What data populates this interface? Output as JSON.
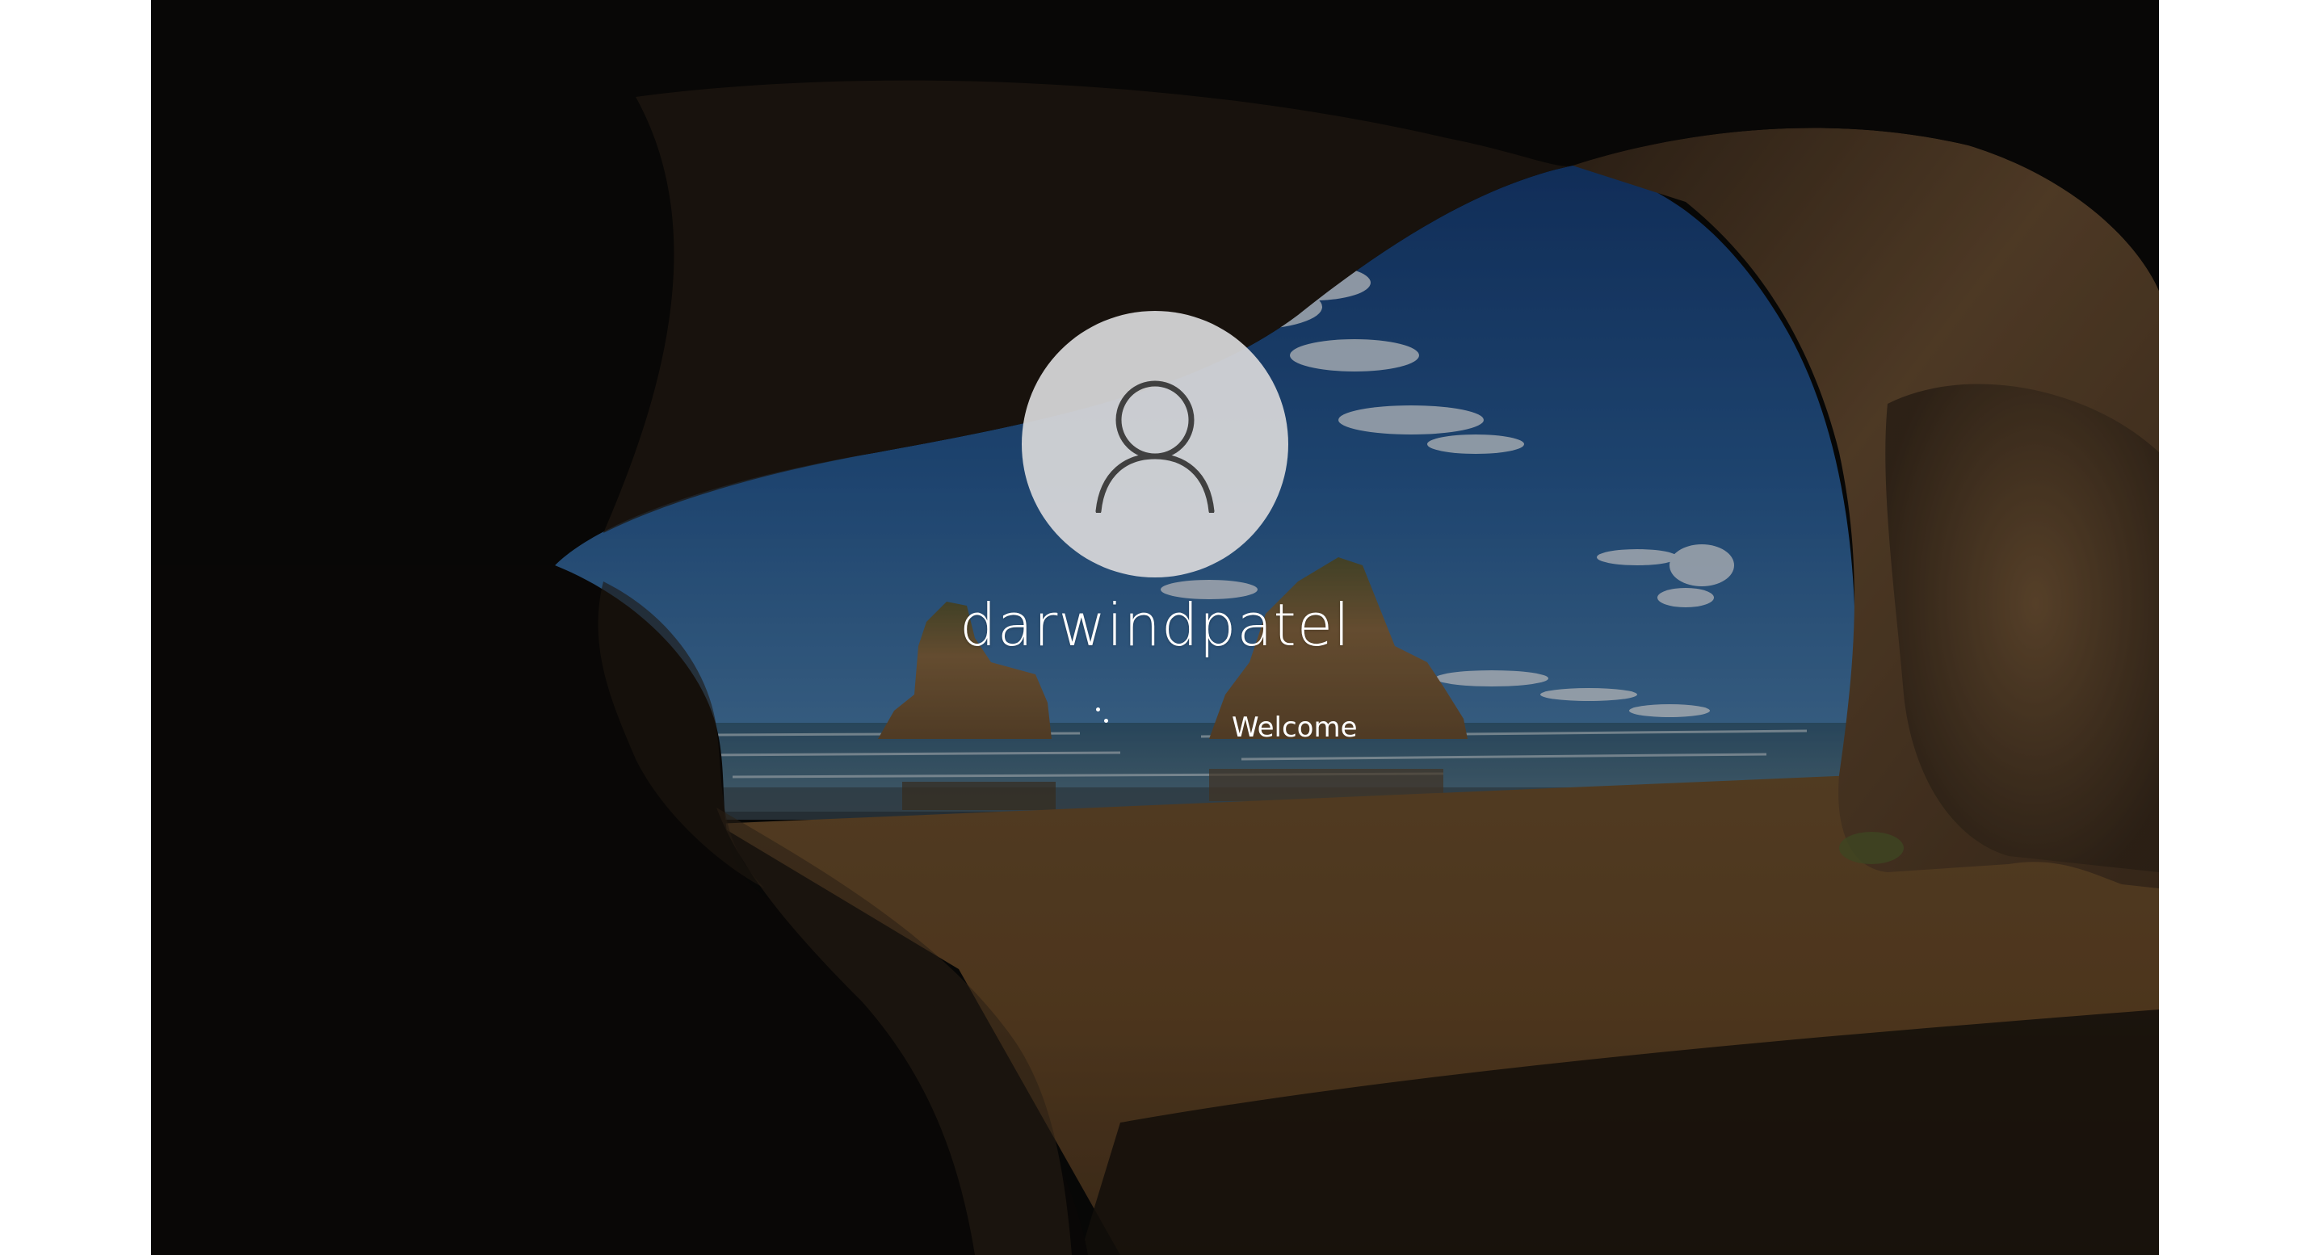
{
  "login_screen": {
    "username": "darwindpatel",
    "status_text": "Welcome",
    "avatar_icon": "user-silhouette-icon",
    "spinner_icon": "loading-dots-icon"
  },
  "theme": {
    "avatar_background": "#d6d6d8",
    "avatar_icon_color": "#404040",
    "text_color": "#ffffff"
  }
}
